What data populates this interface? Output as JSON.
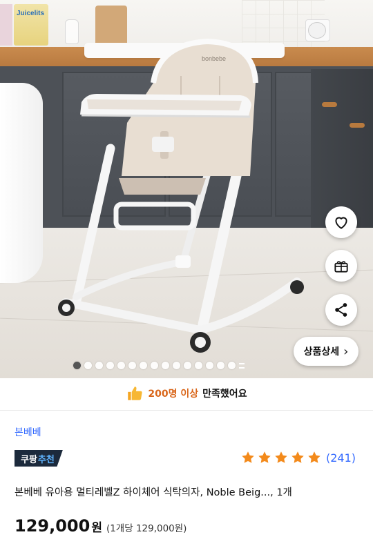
{
  "product_image": {
    "alt_brand_on_seat": "bonbebe",
    "juice_box_label": "Juicelits",
    "carousel": {
      "total_dots": 15,
      "active_index": 0
    }
  },
  "actions": {
    "detail_button_label": "상품상세",
    "detail_button_chevron": "›"
  },
  "satisfaction": {
    "highlight": "200명 이상",
    "rest": "만족했어요"
  },
  "product": {
    "brand": "본베베",
    "badge_part1": "쿠팡",
    "badge_part2": "추천",
    "rating_stars": 5,
    "review_count": "(241)",
    "title": "본베베 유아용 멀티레벨Z 하이체어 식탁의자, Noble Beig..., 1개",
    "price": "129,000",
    "price_currency": "원",
    "unit_price": "(1개당 129,000원)"
  },
  "colors": {
    "accent_blue": "#346aff",
    "star_orange": "#f38a1b",
    "satisfaction_orange": "#d9661a",
    "badge_bg": "#1c2a3c"
  },
  "icons": [
    "heart-icon",
    "gift-icon",
    "share-icon",
    "thumbs-up-icon",
    "star-icon",
    "chevron-right-icon"
  ]
}
